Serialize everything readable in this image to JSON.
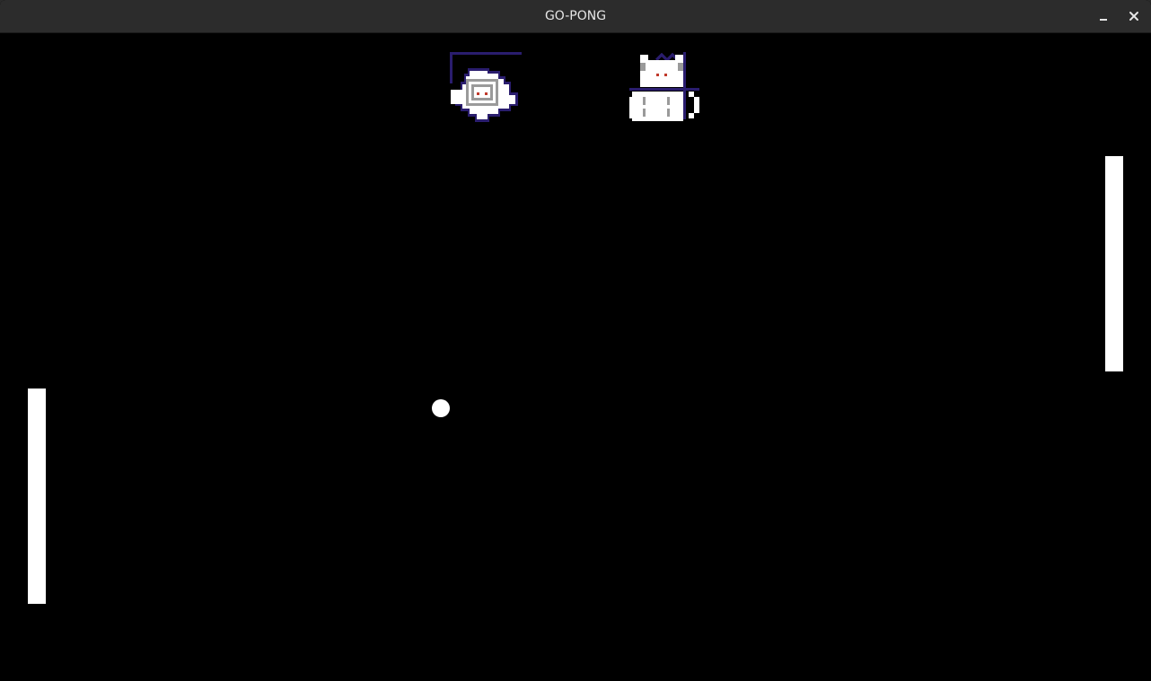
{
  "window": {
    "title": "GO-PONG",
    "minimize_icon": "minimize-icon",
    "close_icon": "close-icon"
  },
  "game": {
    "background_color": "#000000",
    "paddle_color": "#ffffff",
    "ball_color": "#ffffff",
    "left_player_sprite": "ghost-icon",
    "right_player_sprite": "cat-icon",
    "sprite_accent": "#2a1d6e",
    "sprite_eye_color": "#c0392b"
  }
}
